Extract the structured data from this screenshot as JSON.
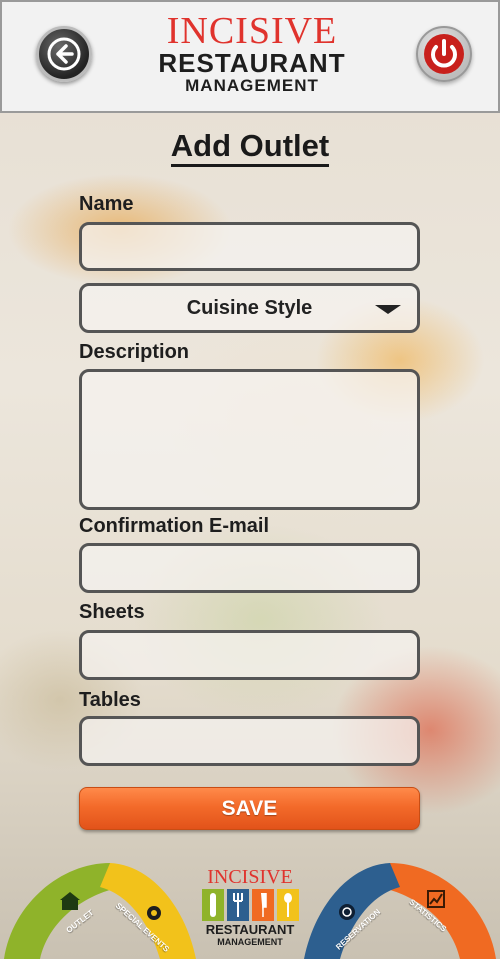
{
  "header": {
    "logo_line1": "INCISIVE",
    "logo_line2": "RESTAURANT",
    "logo_line3": "MANAGEMENT",
    "back_icon": "back-arrow-icon",
    "power_icon": "power-icon"
  },
  "form": {
    "title": "Add Outlet",
    "name_label": "Name",
    "name_value": "",
    "cuisine_selected": "Cuisine Style",
    "description_label": "Description",
    "description_value": "",
    "email_label": "Confirmation E-mail",
    "email_value": "",
    "sheets_label": "Sheets",
    "sheets_value": "",
    "tables_label": "Tables",
    "tables_value": "",
    "save_label": "SAVE"
  },
  "footer": {
    "outlet_label": "OUTLET",
    "special_events_label": "SPECIAL EVENTS",
    "reservation_label": "RESERVATION",
    "statistics_label": "STATISTICS",
    "logo_line1": "INCISIVE",
    "logo_line2": "RESTAURANT",
    "logo_line3": "MANAGEMENT"
  },
  "colors": {
    "accent_orange": "#f36a2a",
    "brand_red": "#e0332d",
    "ribbon_green": "#8fb32a",
    "ribbon_yellow": "#f2c21b",
    "ribbon_blue": "#2d5f8f",
    "ribbon_orange": "#f06a22"
  }
}
